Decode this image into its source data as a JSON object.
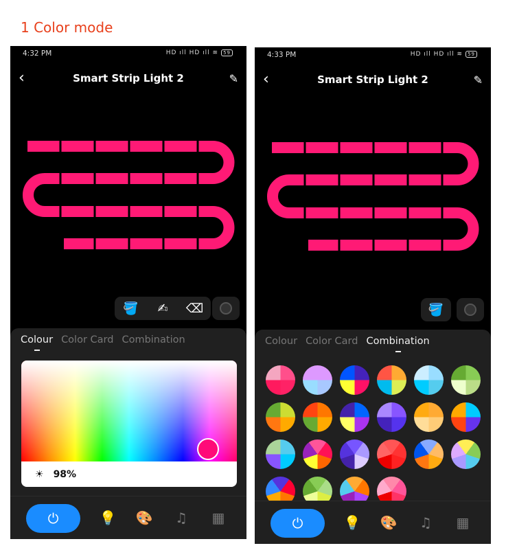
{
  "caption": "1 Color mode",
  "screens": [
    {
      "time": "4:32 PM",
      "signal": "HD ıll HD ıll ≋",
      "battery": "59",
      "title": "Smart Strip Light 2",
      "active_tab": 0,
      "brightness": "98%"
    },
    {
      "time": "4:33 PM",
      "signal": "HD ıll HD ıll ≋",
      "battery": "59",
      "title": "Smart Strip Light 2",
      "active_tab": 2
    }
  ],
  "tabs": [
    "Colour",
    "Color Card",
    "Combination"
  ],
  "strip_color": "#ff1a75",
  "accent": "#1a8cff",
  "selected_color": "#ff0a78",
  "icons": {
    "back": "‹",
    "edit": "✎",
    "paint": "🪣",
    "brush": "✍",
    "eraser": "⌫",
    "brightness": "☀",
    "power": "⏻",
    "bulb": "💡",
    "palette": "🎨",
    "music": "♫",
    "grid": "▦"
  },
  "combinations": [
    [
      "#ff4f8b",
      "#ff2266",
      "#ff1a5e",
      "#f4a6c0"
    ],
    [
      "#dd99ff",
      "#a8c8ff",
      "#99ddff",
      "#dd99ff"
    ],
    [
      "#4422bb",
      "#ff1166",
      "#ffff33",
      "#0055ff"
    ],
    [
      "#ffaa33",
      "#ddee55",
      "#00bbee",
      "#ff5544"
    ],
    [
      "#99ddff",
      "#55ccee",
      "#00ccff",
      "#cceeff"
    ],
    [
      "#88cc55",
      "#bbdd88",
      "#eeffcc",
      "#66aa33"
    ],
    [
      "#ccdd33",
      "#ffaa00",
      "#ff7711",
      "#66aa33"
    ],
    [
      "#ff7700",
      "#ffaa00",
      "#66aa33",
      "#ff4411"
    ],
    [
      "#0066ff",
      "#aa33ee",
      "#ffff66",
      "#4422aa"
    ],
    [
      "#8855ff",
      "#5533ee",
      "#4422bb",
      "#aa88ff"
    ],
    [
      "#ffaa33",
      "#ffcc77",
      "#ffdd99",
      "#ffaa11"
    ],
    [
      "#00ccff",
      "#6633ee",
      "#ff4411",
      "#ffaa00"
    ],
    [
      "#55ccee",
      "#00ccff",
      "#8855ff",
      "#aad499"
    ],
    [
      "#ff5599",
      "#ff1155",
      "#ff6600",
      "#ffff33",
      "#9922bb"
    ],
    [
      "#7755ff",
      "#aa99ff",
      "#ddccff",
      "#4422aa",
      "#5533dd"
    ],
    [
      "#ff5555",
      "#ff3333",
      "#ff2222",
      "#ee0000",
      "#ff6666"
    ],
    [
      "#88aaff",
      "#ffbb66",
      "#ffaa11",
      "#ff7711",
      "#0055ee"
    ],
    [
      "#ffee55",
      "#88cc55",
      "#55ccee",
      "#aa99ff",
      "#ddaaff"
    ],
    [
      "#5533dd",
      "#ff0033",
      "#ff7700",
      "#ffaa00",
      "#3388ff"
    ],
    [
      "#88cc55",
      "#aadd88",
      "#ddee44",
      "#eeff99",
      "#66aa33"
    ],
    [
      "#ffaa33",
      "#ff7700",
      "#aa44ff",
      "#9922bb",
      "#55ccee"
    ],
    [
      "#ff88aa",
      "#ff5599",
      "#ff3366",
      "#ee0000",
      "#ffaacc"
    ]
  ]
}
